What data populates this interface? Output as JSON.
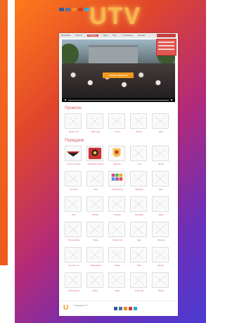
{
  "brand": {
    "logo_text": "UTV"
  },
  "nav": {
    "items": [
      "Программа",
      "Проекты",
      "Передачи",
      "Эфир",
      "Фото",
      "О телеканале",
      "Реклама"
    ],
    "active": "Передачи"
  },
  "hero": {
    "badge": "Смотри эфир UTV"
  },
  "sections": {
    "projects_title": "Проекты",
    "shows_title": "Передачи"
  },
  "projects": [
    {
      "label": "Проект UTV"
    },
    {
      "label": "Мой город"
    },
    {
      "label": "Спорт"
    },
    {
      "label": "Регион"
    },
    {
      "label": "Дети"
    }
  ],
  "shows": [
    {
      "label": "Прогноз погоды",
      "icon": "wing-logo"
    },
    {
      "label": "Уфимские новости",
      "icon": "emblem-red"
    },
    {
      "label": "Маршрут",
      "icon": "emblem-crest"
    },
    {
      "label": "Утро",
      "icon": "placeholder"
    },
    {
      "label": "Вечер",
      "icon": "placeholder"
    },
    {
      "label": "Культура",
      "icon": "placeholder"
    },
    {
      "label": "Кино",
      "icon": "placeholder"
    },
    {
      "label": "Пятиминутка",
      "icon": "grid-colorful"
    },
    {
      "label": "Здоровье",
      "icon": "placeholder"
    },
    {
      "label": "Дом",
      "icon": "placeholder"
    },
    {
      "label": "Авто",
      "icon": "placeholder"
    },
    {
      "label": "Бизнес",
      "icon": "placeholder"
    },
    {
      "label": "Музыка",
      "icon": "placeholder"
    },
    {
      "label": "Интервью",
      "icon": "placeholder"
    },
    {
      "label": "Мода",
      "icon": "placeholder"
    },
    {
      "label": "Путешествия",
      "icon": "placeholder"
    },
    {
      "label": "Город",
      "icon": "placeholder"
    },
    {
      "label": "Технологии",
      "icon": "placeholder"
    },
    {
      "label": "Еда",
      "icon": "placeholder"
    },
    {
      "label": "История",
      "icon": "placeholder"
    },
    {
      "label": "Кто есть кто",
      "icon": "placeholder"
    },
    {
      "label": "Наша семья",
      "icon": "placeholder"
    },
    {
      "label": "Время",
      "icon": "placeholder"
    },
    {
      "label": "Люди",
      "icon": "placeholder"
    },
    {
      "label": "Выпуск",
      "icon": "placeholder"
    },
    {
      "label": "Образование",
      "icon": "placeholder"
    },
    {
      "label": "Факты",
      "icon": "placeholder"
    },
    {
      "label": "Эфир",
      "icon": "placeholder"
    },
    {
      "label": "Спорт дня",
      "icon": "placeholder"
    },
    {
      "label": "Финал",
      "icon": "placeholder"
    }
  ],
  "footer": {
    "logo_text": "U",
    "copyright": "© Телеканал UTV"
  },
  "colors": {
    "accent": "#d35d5d",
    "nav_active": "#d34a4a",
    "logo_glow": "#f7b64a"
  }
}
